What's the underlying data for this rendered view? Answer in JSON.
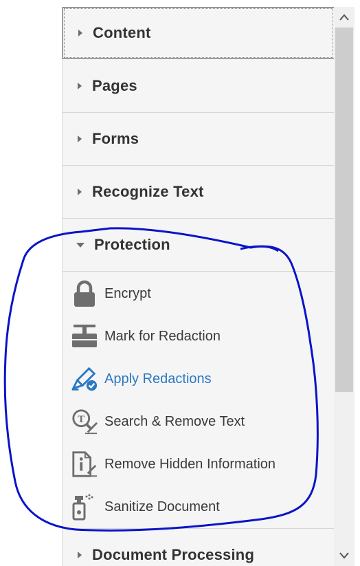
{
  "sections": {
    "content": "Content",
    "pages": "Pages",
    "forms": "Forms",
    "recognize_text": "Recognize Text",
    "protection": "Protection",
    "document_processing": "Document Processing"
  },
  "protection_tools": {
    "encrypt": "Encrypt",
    "mark_for_redaction": "Mark for Redaction",
    "apply_redactions": "Apply Redactions",
    "search_remove_text": "Search & Remove Text",
    "remove_hidden_information": "Remove Hidden Information",
    "sanitize_document": "Sanitize Document"
  },
  "icons": {
    "collapsed": "caret-right-icon",
    "expanded": "caret-down-icon",
    "encrypt": "lock-icon",
    "mark_for_redaction": "redaction-marker-icon",
    "apply_redactions": "redaction-pen-check-icon",
    "search_remove_text": "search-remove-text-icon",
    "remove_hidden_information": "hidden-info-document-icon",
    "sanitize_document": "spray-bottle-icon",
    "scroll_up": "chevron-up-icon",
    "scroll_down": "chevron-down-icon"
  },
  "colors": {
    "active_tool": "#2b78c5",
    "annotation": "#0a14c8",
    "panel_background": "#f5f5f5"
  }
}
